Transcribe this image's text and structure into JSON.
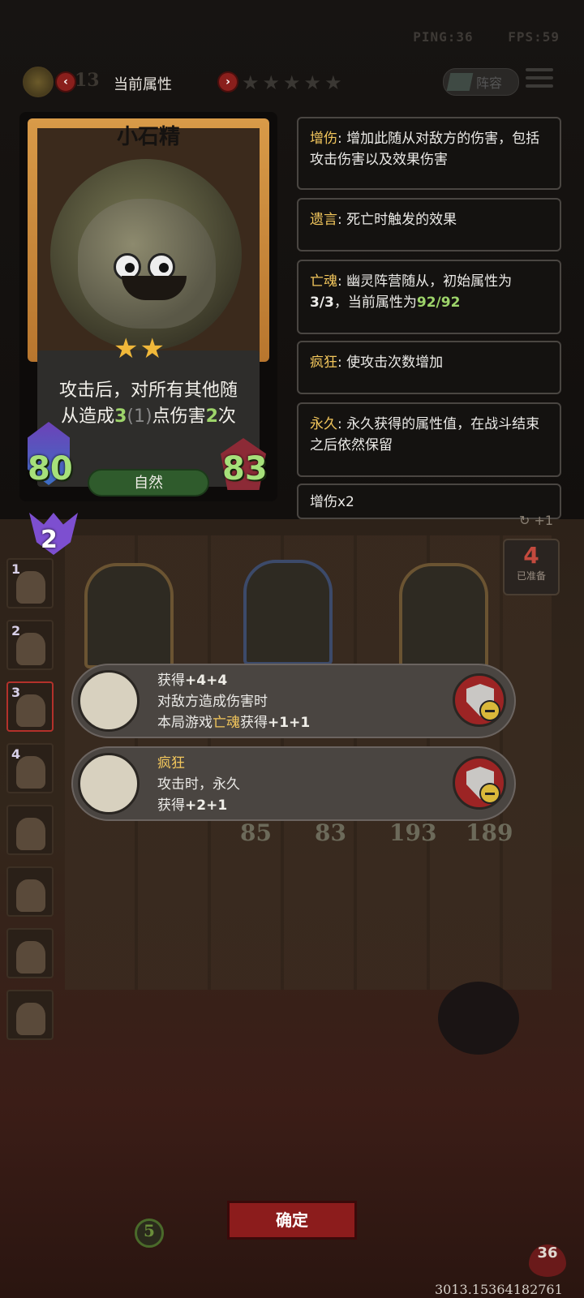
{
  "status": {
    "ping": "PING:36",
    "fps": "FPS:59"
  },
  "header": {
    "coins": "13",
    "title": "当前属性",
    "prev_icon": "chevron-left-icon",
    "next_icon": "chevron-right-icon",
    "stars": "★★★★★",
    "lineup_label": "阵容"
  },
  "card": {
    "name": "小石精",
    "stars": "★★",
    "desc_line1": "攻击后，对所有其他随",
    "desc_line2_pre": "从造成",
    "desc_num": "3",
    "desc_paren": "(1)",
    "desc_mid": "点伤害",
    "desc_times": "2",
    "desc_end": "次",
    "attack": "80",
    "health": "83",
    "tribe": "自然"
  },
  "keywords": [
    {
      "key": "增伤",
      "text": ": 增加此随从对敌方的伤害，包括攻击伤害以及效果伤害"
    },
    {
      "key": "遗言",
      "text": ": 死亡时触发的效果"
    },
    {
      "key": "亡魂",
      "text": ": 幽灵阵营随从，初始属性为",
      "line2_a": "3/3",
      "line2_b": "，当前属性为",
      "line2_c": "92/92"
    },
    {
      "key": "疯狂",
      "text": ": 使攻击次数增加"
    },
    {
      "key": "永久",
      "text": ": 永久获得的属性值，在战斗结束之后依然保留"
    },
    {
      "text": "增伤x2"
    }
  ],
  "board": {
    "tier": "2",
    "refresh_label": "+1",
    "prepared_count": "4",
    "prepared_label": "已准备",
    "side_slots": [
      "1",
      "2",
      "3",
      "4"
    ],
    "minion_stats": [
      "85",
      "83",
      "193",
      "189"
    ]
  },
  "enchants": [
    {
      "line1_pre": "获得",
      "line1_val": "+4+4",
      "line2": "对敌方造成伤害时",
      "line3_pre": "本局游戏",
      "line3_key": "亡魂",
      "line3_mid": "获得",
      "line3_val": "+1+1",
      "icon": "electric-sword-icon"
    },
    {
      "line1": "疯狂",
      "line2": "攻击时，永久",
      "line3_pre": "获得",
      "line3_val": "+2+1",
      "icon": "crossed-swords-icon"
    }
  ],
  "footer": {
    "confirm_label": "确定",
    "gold": "5",
    "life": "36",
    "version": "3013.15364182761"
  }
}
